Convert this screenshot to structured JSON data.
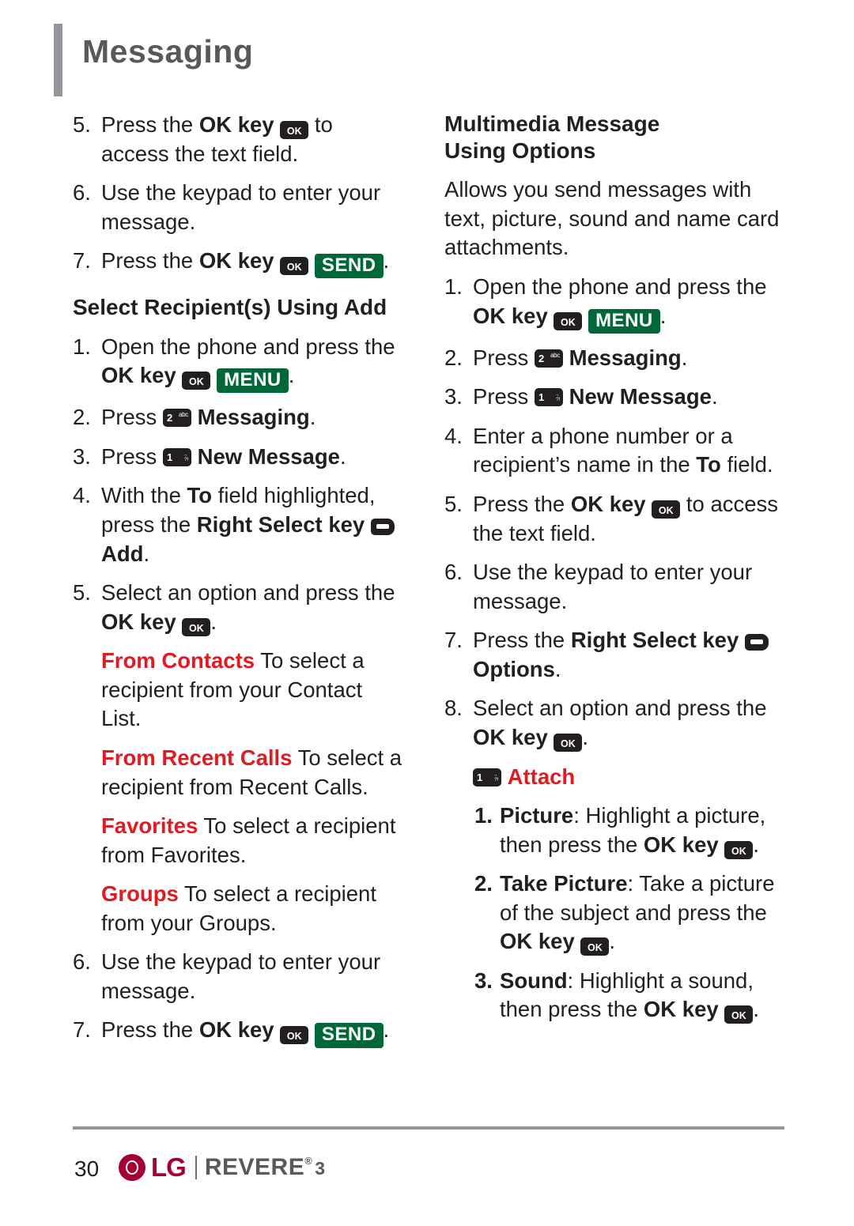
{
  "page": {
    "title": "Messaging",
    "number": "30",
    "footer_brand": "LG",
    "footer_model": "REVERE",
    "footer_model_sup": "®",
    "footer_model_num": "3"
  },
  "keys": {
    "ok": "OK",
    "menu": "MENU",
    "send": "SEND",
    "num1": "1",
    "num1_alt_top": ".,",
    "num1_alt_bottom": "?!",
    "num2": "2",
    "num2_alt": "abc"
  },
  "left_column": {
    "steps_top": [
      {
        "num": "5.",
        "parts": [
          {
            "t": "text",
            "v": "Press the "
          },
          {
            "t": "bold",
            "v": "OK key "
          },
          {
            "t": "key-ok"
          },
          {
            "t": "text",
            "v": " to access the text field."
          }
        ]
      },
      {
        "num": "6.",
        "parts": [
          {
            "t": "text",
            "v": "Use the keypad to enter your message."
          }
        ]
      },
      {
        "num": "7.",
        "parts": [
          {
            "t": "text",
            "v": "Press the "
          },
          {
            "t": "bold",
            "v": "OK key "
          },
          {
            "t": "key-ok"
          },
          {
            "t": "text",
            "v": " "
          },
          {
            "t": "key-send"
          },
          {
            "t": "text",
            "v": "."
          }
        ]
      }
    ],
    "heading": "Select Recipient(s) Using Add",
    "steps": [
      {
        "num": "1.",
        "html": "Open the phone and press the <b>OK key</b> KEYOK KEYMENU."
      },
      {
        "num": "2.",
        "html": "Press KEYNUM2 <b>Messaging</b>."
      },
      {
        "num": "3.",
        "html": "Press KEYNUM1 <b>New Message</b>."
      },
      {
        "num": "4.",
        "html": "With the <b>To</b> field highlighted, press the <b>Right Select key</b> KEYSOFT <b>Add</b>."
      },
      {
        "num": "5.",
        "html": "Select an option and press the <b>OK key</b> KEYOK."
      }
    ],
    "options": [
      {
        "label": "From Contacts",
        "text": " To select a recipient from your Contact List."
      },
      {
        "label": "From Recent Calls",
        "text": " To select a recipient from Recent Calls."
      },
      {
        "label": "Favorites",
        "text": " To select a recipient from Favorites."
      },
      {
        "label": "Groups",
        "text": " To select a recipient from your Groups."
      }
    ],
    "steps_end": [
      {
        "num": "6.",
        "html": "Use the keypad to enter your message."
      },
      {
        "num": "7.",
        "html": "Press the <b>OK key</b> KEYOK KEYSEND."
      }
    ]
  },
  "right_column": {
    "heading_line1": "Multimedia Message",
    "heading_line2": "Using Options",
    "intro": "Allows you send messages with text, picture, sound and name card attachments.",
    "steps": [
      {
        "num": "1.",
        "html": "Open the phone and press the <b>OK key</b> KEYOK KEYMENU."
      },
      {
        "num": "2.",
        "html": "Press KEYNUM2 <b>Messaging</b>."
      },
      {
        "num": "3.",
        "html": "Press KEYNUM1 <b>New Message</b>."
      },
      {
        "num": "4.",
        "html": "Enter a phone number or a recipient’s name in the <b>To</b> field."
      },
      {
        "num": "5.",
        "html": "Press the <b>OK key</b> KEYOK to access the text field."
      },
      {
        "num": "6.",
        "html": "Use the keypad to enter your message."
      },
      {
        "num": "7.",
        "html": "Press the <b>Right Select key</b> KEYSOFT <b>Options</b>."
      },
      {
        "num": "8.",
        "html": "Select an option and press the <b>OK key</b> KEYOK."
      }
    ],
    "attach_label": "Attach",
    "attach_items": [
      {
        "num": "1.",
        "label": "Picture",
        "text": ": Highlight a picture, then press the <b>OK key</b> KEYOK."
      },
      {
        "num": "2.",
        "label": "Take Picture",
        "text": ": Take a picture of the subject and press the <b>OK key</b> KEYOK."
      },
      {
        "num": "3.",
        "label": "Sound",
        "text": ": Highlight a sound, then press the <b>OK key</b> KEYOK."
      }
    ]
  }
}
